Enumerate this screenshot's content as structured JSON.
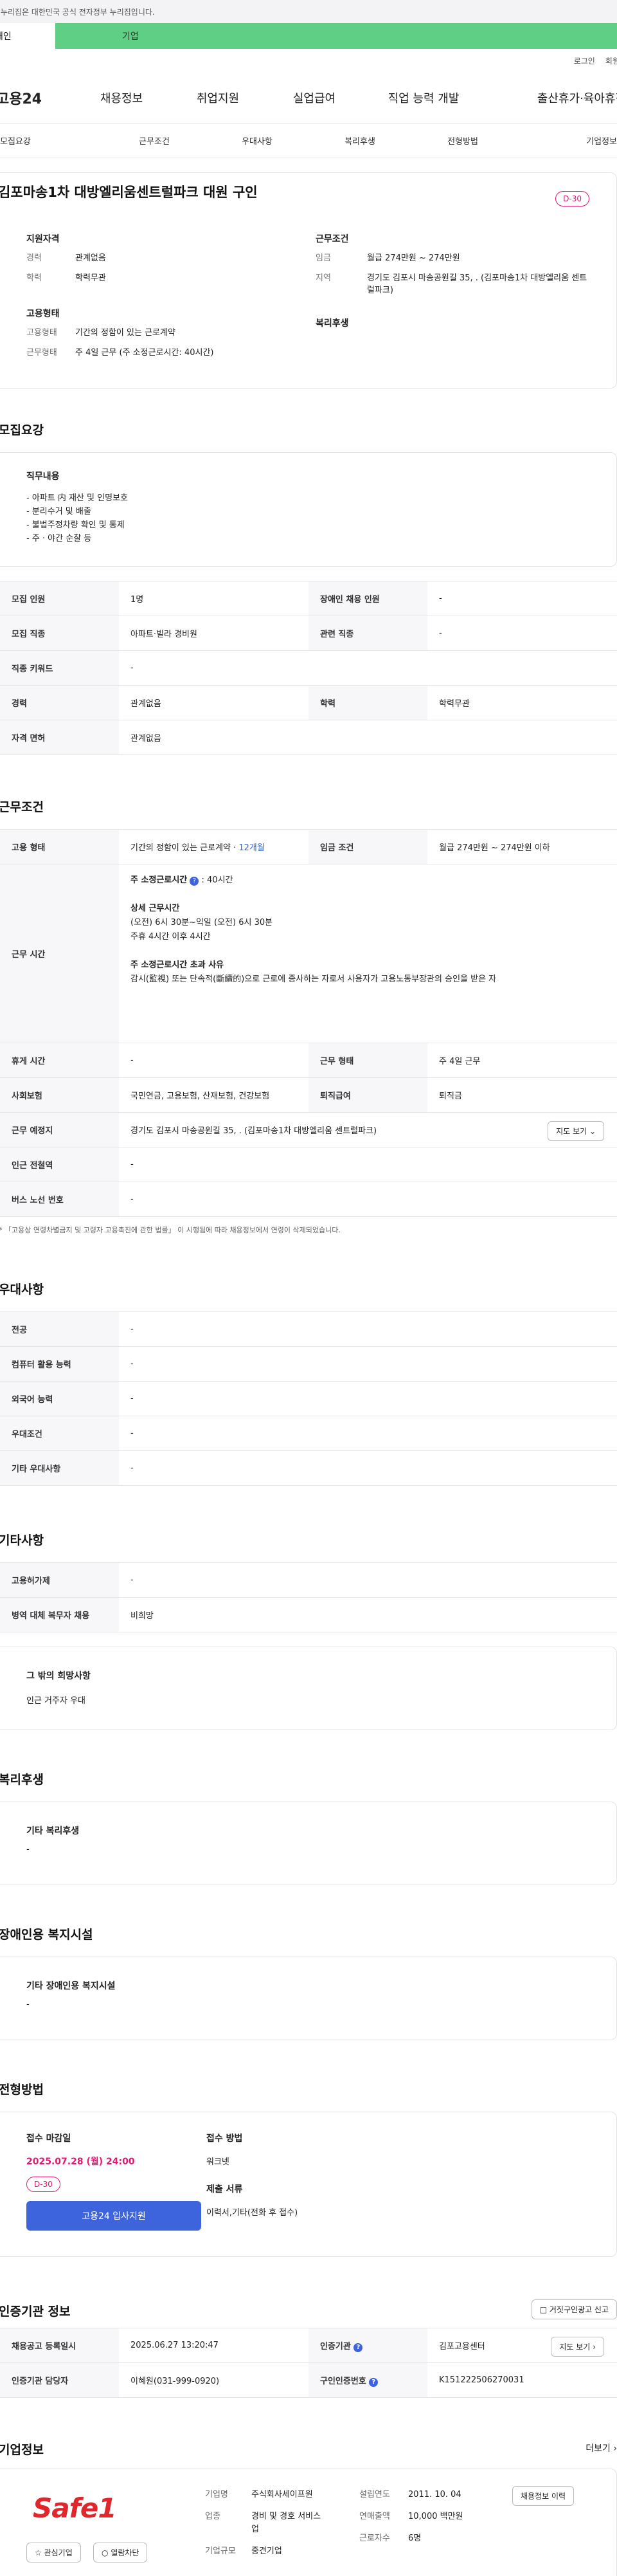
{
  "gov_banner": "이 누리집은 대한민국 공식 전자정부 누리집입니다.",
  "site_switch": {
    "individual": "개인",
    "company": "기업"
  },
  "util": {
    "login": "로그인",
    "signup": "회원가입"
  },
  "gnb": {
    "logo": "고용24",
    "items": [
      "채용정보",
      "취업지원",
      "실업급여",
      "직업 능력 개발",
      "출산휴가·육아휴직"
    ]
  },
  "tabs": [
    "모집요강",
    "근무조건",
    "우대사항",
    "복리후생",
    "전형방법",
    "기업정보"
  ],
  "job": {
    "title": "김포마송1차 대방엘리움센트럴파크 대원 구인",
    "dday": "D-30",
    "qual_title": "지원자격",
    "qual": [
      {
        "k": "경력",
        "v": "관계없음"
      },
      {
        "k": "학력",
        "v": "학력무관"
      }
    ],
    "emp_title": "고용형태",
    "emp": [
      {
        "k": "고용형태",
        "v": "기간의 정함이 있는 근로계약"
      },
      {
        "k": "근무형태",
        "v": "주 4일 근무 (주 소정근로시간: 40시간)"
      }
    ],
    "cond_title": "근무조건",
    "cond": [
      {
        "k": "임금",
        "v": "월급 274만원 ~ 274만원"
      },
      {
        "k": "지역",
        "v": "경기도 김포시 마송공원길 35, . (김포마송1차 대방엘리움 센트럴파크)"
      }
    ],
    "welfare_title": "복리후생"
  },
  "recruit": {
    "section": "모집요강",
    "duty_title": "직무내용",
    "duty_lines": [
      "- 아파트 内 재산 및 인명보호",
      "- 분리수거 및 배출",
      "- 불법주정차량 확인 및 통제",
      "- 주 · 야간 순찰 등"
    ],
    "rows": [
      [
        {
          "h": "모집 인원",
          "v": "1명"
        },
        {
          "h": "장애인 채용 인원",
          "v": "-"
        }
      ],
      [
        {
          "h": "모집 직종",
          "v": "아파트·빌라 경비원"
        },
        {
          "h": "관련 직종",
          "v": "-"
        }
      ],
      [
        {
          "h": "직종 키워드",
          "v": "-"
        }
      ],
      [
        {
          "h": "경력",
          "v": "관계없음"
        },
        {
          "h": "학력",
          "v": "학력무관"
        }
      ],
      [
        {
          "h": "자격 면허",
          "v": "관계없음"
        }
      ]
    ]
  },
  "work": {
    "section": "근무조건",
    "emp_h": "고용 형태",
    "emp_v": "기간의 정함이 있는 근로계약 · ",
    "emp_v2": "12개월",
    "wage_h": "임금 조건",
    "wage_v": "월급 274만원 ~ 274만원 이하",
    "time_h": "근무 시간",
    "time_label1": "주 소정근로시간",
    "time_val1": ": 40시간",
    "time_detail_h": "상세 근무시간",
    "time_detail_1": "(오전) 6시 30분~익일 (오전) 6시 30분",
    "time_detail_2": "주휴 4시간 이후 4시간",
    "time_over_h": "주 소정근로시간 초과 사유",
    "time_over_v": "감시(監視) 또는 단속적(斷續的)으로 근로에 종사하는 자로서 사용자가 고용노동부장관의 승인을 받은 자",
    "rest_h": "휴게 시간",
    "rest_v": "-",
    "form_h": "근무 형태",
    "form_v": "주 4일 근무",
    "ins_h": "사회보험",
    "ins_v": "국민연금, 고용보험, 산재보험, 건강보험",
    "pay_h": "퇴직급여",
    "pay_v": "퇴직금",
    "place_h": "근무 예정지",
    "place_v": "경기도 김포시 마송공원길 35, . (김포마송1차 대방엘리움 센트럴파크)",
    "map_btn": "지도 보기",
    "subway_h": "인근 전철역",
    "subway_v": "-",
    "bus_h": "버스 노선 번호",
    "bus_v": "-",
    "note": "* 「고용상 연령차별금지 및 고령자 고용촉진에 관한 법률」 이 시행됨에 따라 채용정보에서 연령이 삭제되었습니다."
  },
  "pref": {
    "section": "우대사항",
    "rows": [
      {
        "h": "전공",
        "v": "-"
      },
      {
        "h": "컴퓨터 활용 능력",
        "v": "-"
      },
      {
        "h": "외국어 능력",
        "v": "-"
      },
      {
        "h": "우대조건",
        "v": "-"
      },
      {
        "h": "기타 우대사항",
        "v": "-"
      }
    ]
  },
  "etc": {
    "section": "기타사항",
    "rows": [
      {
        "h": "고용허가제",
        "v": "-"
      },
      {
        "h": "병역 대체 복무자 채용",
        "v": "비희망"
      }
    ],
    "other_title": "그 밖의 희망사항",
    "other_v": "인근 거주자 우대"
  },
  "welfare": {
    "section": "복리후생",
    "title": "기타 복리후생",
    "v": "-"
  },
  "disabled": {
    "section": "장애인용 복지시설",
    "title": "기타 장애인용 복지시설",
    "v": "-"
  },
  "process": {
    "section": "전형방법",
    "deadline_h": "접수 마감일",
    "deadline_v": "2025.07.28 (월) 24:00",
    "dday": "D-30",
    "apply_btn": "고용24 입사지원",
    "method_h": "접수 방법",
    "method_v": "워크넷",
    "docs_h": "제출 서류",
    "docs_v": "이력서,기타(전화 후 접수)"
  },
  "cert": {
    "section": "인증기관 정보",
    "report_btn": "거짓구인광고 신고",
    "r1": [
      {
        "h": "채용공고 등록일시",
        "v": "2025.06.27 13:20:47"
      },
      {
        "h": "인증기관",
        "v": "김포고용센터"
      }
    ],
    "map_btn": "지도 보기",
    "r2": [
      {
        "h": "인증기관 담당자",
        "v": "이혜원(031-999-0920)"
      },
      {
        "h": "구인인증번호",
        "v": "K151222506270031"
      }
    ]
  },
  "company": {
    "section": "기업정보",
    "more": "더보기",
    "logo_text": "Safe1",
    "fav_btn": "관심기업",
    "block_btn": "열람차단",
    "f": [
      {
        "h": "기업명",
        "v": "주식회사세이프원"
      },
      {
        "h": "업종",
        "v": "경비 및 경호 서비스업"
      },
      {
        "h": "기업규모",
        "v": "중견기업"
      }
    ],
    "g": [
      {
        "h": "설립연도",
        "v": "2011. 10. 04"
      },
      {
        "h": "연매출액",
        "v": "10,000 백만원"
      },
      {
        "h": "근로자수",
        "v": "6명"
      }
    ],
    "recruit_btn": "채용정보 이력"
  },
  "colors": {
    "accent": "#3d63dd",
    "green": "#5fcf86",
    "dday": "#e1196f"
  }
}
